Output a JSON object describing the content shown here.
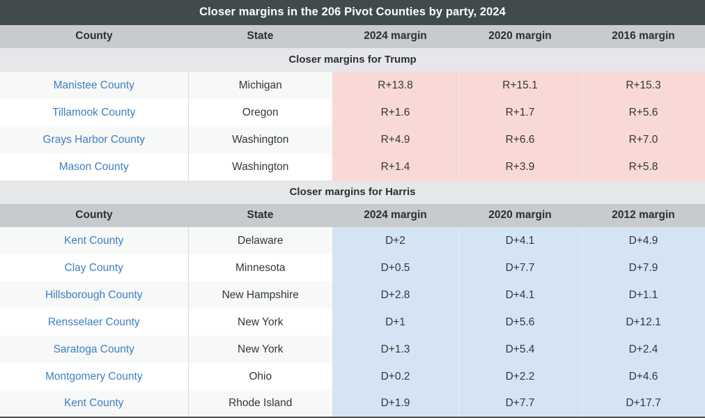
{
  "table": {
    "title": "Closer margins in the 206 Pivot Counties by party, 2024",
    "colors": {
      "title_bar": "#414b4b",
      "column_header": "#c7cace",
      "section_header": "#e6e7e9",
      "republican_tint": "#f8d9d6",
      "democrat_tint": "#d4e4f4",
      "link_blue": "#3d7fc1",
      "text": "#333638"
    },
    "sections": [
      {
        "heading": "Closer margins for Trump",
        "columns": [
          "County",
          "State",
          "2024 margin",
          "2020 margin",
          "2016 margin"
        ],
        "rows": [
          {
            "county": "Manistee County",
            "state": "Michigan",
            "m1": "R+13.8",
            "m2": "R+15.1",
            "m3": "R+15.3"
          },
          {
            "county": "Tillamook County",
            "state": "Oregon",
            "m1": "R+1.6",
            "m2": "R+1.7",
            "m3": "R+5.6"
          },
          {
            "county": "Grays Harbor County",
            "state": "Washington",
            "m1": "R+4.9",
            "m2": "R+6.6",
            "m3": "R+7.0"
          },
          {
            "county": "Mason County",
            "state": "Washington",
            "m1": "R+1.4",
            "m2": "R+3.9",
            "m3": "R+5.8"
          }
        ]
      },
      {
        "heading": "Closer margins for Harris",
        "columns": [
          "County",
          "State",
          "2024 margin",
          "2020 margin",
          "2012 margin"
        ],
        "rows": [
          {
            "county": "Kent County",
            "state": "Delaware",
            "m1": "D+2",
            "m2": "D+4.1",
            "m3": "D+4.9"
          },
          {
            "county": "Clay County",
            "state": "Minnesota",
            "m1": "D+0.5",
            "m2": "D+7.7",
            "m3": "D+7.9"
          },
          {
            "county": "Hillsborough County",
            "state": "New Hampshire",
            "m1": "D+2.8",
            "m2": "D+4.1",
            "m3": "D+1.1"
          },
          {
            "county": "Rensselaer County",
            "state": "New York",
            "m1": "D+1",
            "m2": "D+5.6",
            "m3": "D+12.1"
          },
          {
            "county": "Saratoga County",
            "state": "New York",
            "m1": "D+1.3",
            "m2": "D+5.4",
            "m3": "D+2.4"
          },
          {
            "county": "Montgomery County",
            "state": "Ohio",
            "m1": "D+0.2",
            "m2": "D+2.2",
            "m3": "D+4.6"
          },
          {
            "county": "Kent County",
            "state": "Rhode Island",
            "m1": "D+1.9",
            "m2": "D+7.7",
            "m3": "D+17.7"
          }
        ]
      }
    ]
  }
}
